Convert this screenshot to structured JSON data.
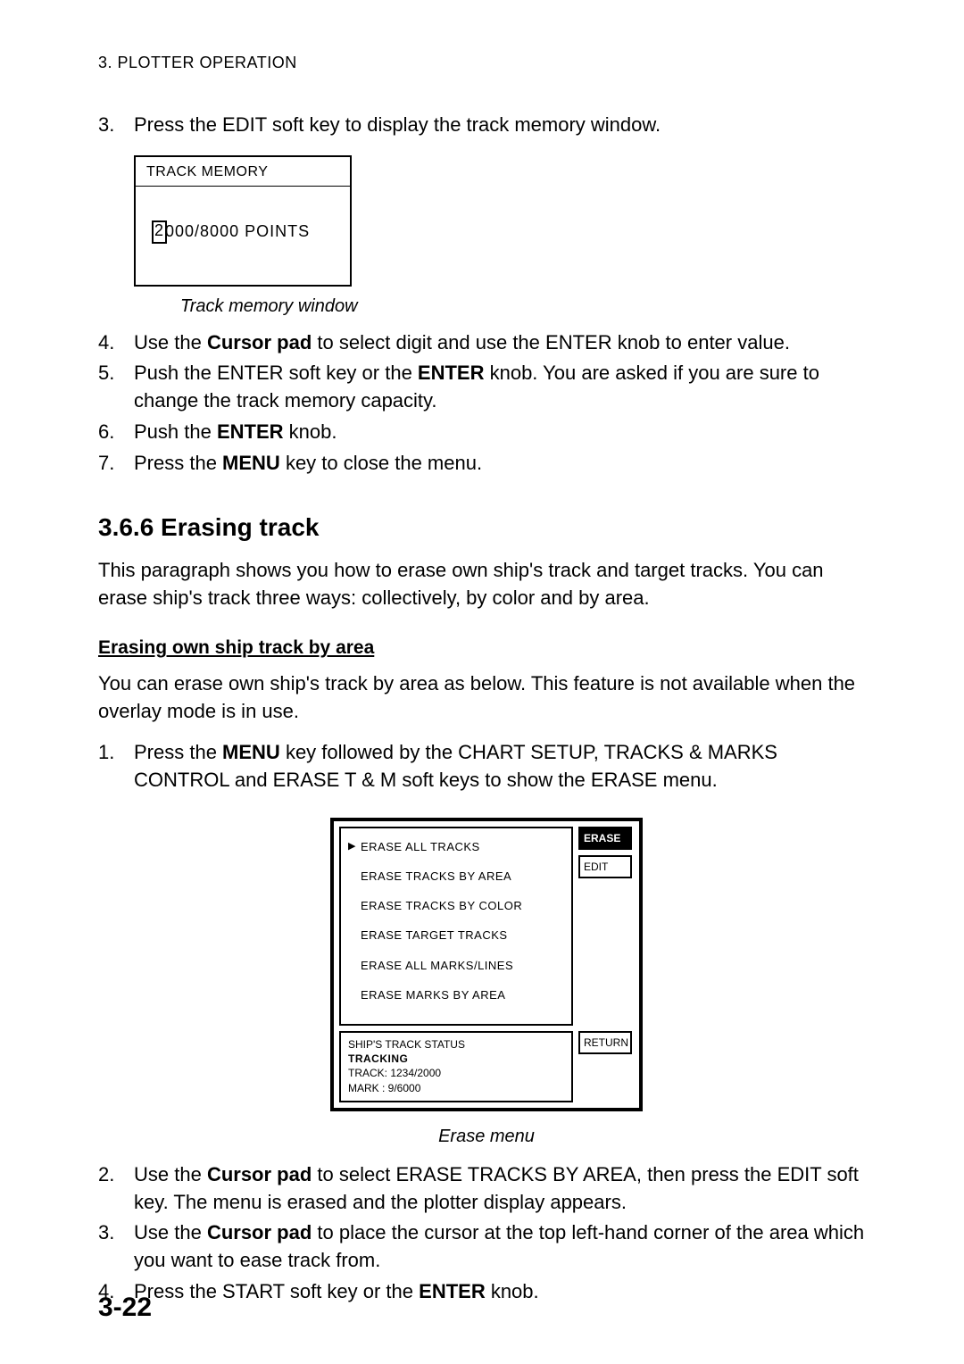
{
  "running_head": "3. PLOTTER OPERATION",
  "step3": {
    "num": "3.",
    "text_a": "Press the EDIT soft key to display the track memory window."
  },
  "track_memory": {
    "title": "TRACK MEMORY",
    "boxed_digit": "2",
    "rest": "000/8000 POINTS",
    "caption": "Track memory window"
  },
  "step4": {
    "num": "4.",
    "a": "Use the ",
    "b": "Cursor pad",
    "c": " to select digit and use the ENTER knob to enter value."
  },
  "step5": {
    "num": "5.",
    "a": "Push the ENTER soft key or the ",
    "b": "ENTER",
    "c": " knob. You are asked if you are sure to change the track memory capacity."
  },
  "step6": {
    "num": "6.",
    "a": "Push the ",
    "b": "ENTER",
    "c": " knob."
  },
  "step7": {
    "num": "7.",
    "a": "Press the ",
    "b": "MENU",
    "c": " key to close the menu."
  },
  "sec_heading": "3.6.6   Erasing track",
  "sec_para": "This paragraph shows you how to erase own ship's track and target tracks. You can erase ship's track three ways: collectively, by color and by area.",
  "sub_heading": "Erasing own ship track by area",
  "sub_para": "You can erase own ship's track by area as below. This feature is not available when the overlay mode is in use.",
  "sstep1": {
    "num": "1.",
    "a": "Press the ",
    "b": "MENU",
    "c": " key followed by the CHART SETUP, TRACKS & MARKS CONTROL and ERASE T & M soft keys to show the ERASE menu."
  },
  "erase_menu": {
    "items": [
      "ERASE ALL TRACKS",
      "ERASE TRACKS BY AREA",
      "ERASE TRACKS BY COLOR",
      "ERASE TARGET TRACKS",
      "ERASE ALL MARKS/LINES",
      "ERASE MARKS BY AREA"
    ],
    "pointer": "▶",
    "sk_erase": "ERASE",
    "sk_edit": "EDIT",
    "sk_return": "RETURN",
    "status_title": "SHIP'S TRACK STATUS",
    "status_tracking": "TRACKING",
    "status_track": "TRACK: 1234/2000",
    "status_mark": "MARK :     9/6000",
    "caption": "Erase menu"
  },
  "sstep2": {
    "num": "2.",
    "a": "Use the ",
    "b": "Cursor pad",
    "c": " to select ERASE TRACKS BY AREA, then press the EDIT soft key. The menu is erased and the plotter display appears."
  },
  "sstep3": {
    "num": "3.",
    "a": "Use the ",
    "b": "Cursor pad",
    "c": " to place the cursor at the top left-hand corner of the area which you want to ease track from."
  },
  "sstep4": {
    "num": "4.",
    "a": "Press the START soft key or the ",
    "b": "ENTER",
    "c": " knob."
  },
  "page_num": "3-22"
}
